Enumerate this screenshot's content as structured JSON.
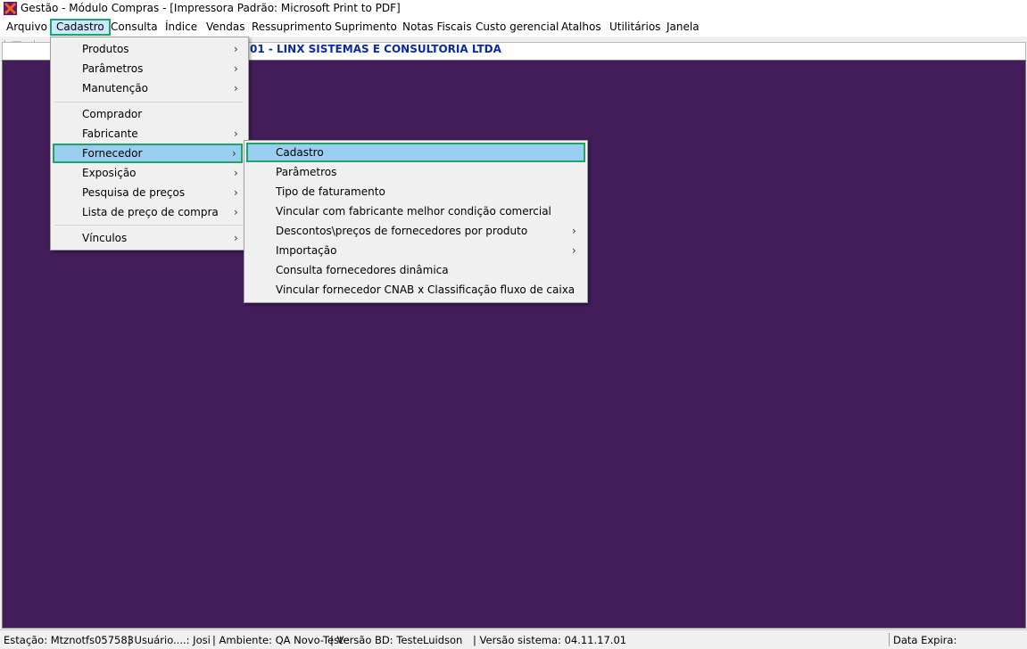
{
  "window": {
    "title": "Gestão  - Módulo Compras - [Impressora Padrão: Microsoft Print to PDF]",
    "icon": "linx-app-icon"
  },
  "menubar": {
    "items": [
      {
        "label": "Arquivo"
      },
      {
        "label": "Cadastro"
      },
      {
        "label": "Consulta"
      },
      {
        "label": "Índice"
      },
      {
        "label": "Vendas"
      },
      {
        "label": "Ressuprimento"
      },
      {
        "label": "Suprimento"
      },
      {
        "label": "Notas Fiscais"
      },
      {
        "label": "Custo gerencial"
      },
      {
        "label": "Atalhos"
      },
      {
        "label": "Utilitários"
      },
      {
        "label": "Janela"
      }
    ],
    "active": "Cadastro"
  },
  "company_bar": {
    "text": "01 - LINX SISTEMAS E CONSULTORIA LTDA"
  },
  "cadastro_menu": {
    "items": [
      {
        "label": "Produtos",
        "submenu": true
      },
      {
        "label": "Parâmetros",
        "submenu": true
      },
      {
        "label": "Manutenção",
        "submenu": true
      },
      {
        "label": "Comprador",
        "submenu": false
      },
      {
        "label": "Fabricante",
        "submenu": true
      },
      {
        "label": "Fornecedor",
        "submenu": true
      },
      {
        "label": "Exposição",
        "submenu": true
      },
      {
        "label": "Pesquisa de preços",
        "submenu": true
      },
      {
        "label": "Lista de preço de compra",
        "submenu": true
      },
      {
        "label": "Vínculos",
        "submenu": true
      }
    ],
    "highlighted": "Fornecedor"
  },
  "fornecedor_submenu": {
    "items": [
      {
        "label": "Cadastro",
        "submenu": false
      },
      {
        "label": "Parâmetros",
        "submenu": false
      },
      {
        "label": "Tipo de faturamento",
        "submenu": false
      },
      {
        "label": "Vincular com fabricante melhor condição comercial",
        "submenu": false
      },
      {
        "label": "Descontos\\preços de fornecedores por produto",
        "submenu": true
      },
      {
        "label": "Importação",
        "submenu": true
      },
      {
        "label": "Consulta fornecedores dinâmica",
        "submenu": false
      },
      {
        "label": "Vincular fornecedor CNAB x Classificação fluxo de caixa",
        "submenu": false
      }
    ],
    "highlighted": "Cadastro"
  },
  "submenu_arrow": "›",
  "statusbar": {
    "estacao": "Estação: Mtznotfs057583",
    "usuario": "| Usuário....: Josi",
    "ambiente": "| Ambiente: QA Novo-Teste",
    "versao_bd": "| Versão BD: TesteLuidson",
    "versao_sistema": "| Versão sistema: 04.11.17.01",
    "data_expira": "Data Expira:"
  },
  "colors": {
    "workspace": "#421d5a",
    "highlight": "#99cef0",
    "focus_outline": "#1fa36b",
    "company_text": "#0c2aa6"
  }
}
